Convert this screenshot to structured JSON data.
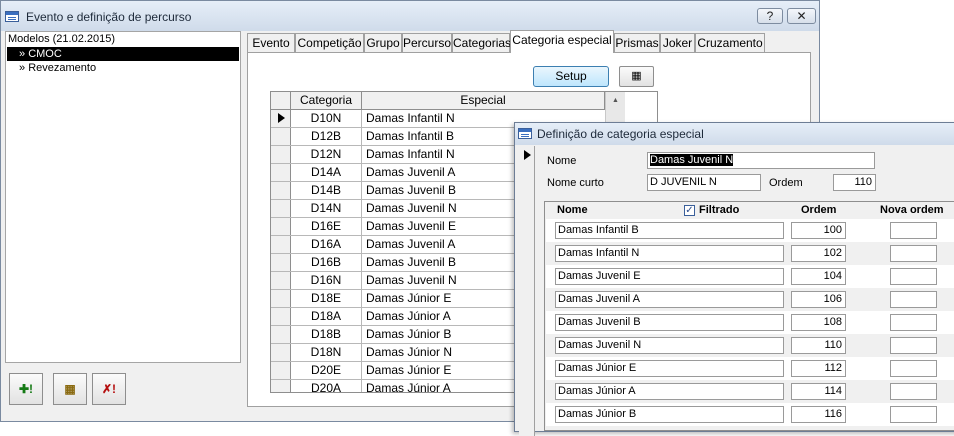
{
  "main_window": {
    "title": "Evento e definição de percurso",
    "help_glyph": "?",
    "close_glyph": "✕"
  },
  "tree": {
    "root": "Modelos (21.02.2015)",
    "items": [
      {
        "label": "CMOC",
        "selected": true
      },
      {
        "label": "Revezamento",
        "selected": false
      }
    ]
  },
  "bottom_buttons": [
    {
      "icon": "add-icon",
      "glyph": "✚!"
    },
    {
      "icon": "edit-table-icon",
      "glyph": "▦"
    },
    {
      "icon": "delete-icon",
      "glyph": "✗!"
    }
  ],
  "tabs": [
    {
      "label": "Evento"
    },
    {
      "label": "Competição"
    },
    {
      "label": "Grupo"
    },
    {
      "label": "Percurso"
    },
    {
      "label": "Categorias"
    },
    {
      "label": "Categoria especial",
      "active": true
    },
    {
      "label": "Prismas"
    },
    {
      "label": "Joker"
    },
    {
      "label": "Cruzamento"
    }
  ],
  "toolbar": {
    "setup_label": "Setup",
    "add_glyph": "▦"
  },
  "grid": {
    "columns": [
      "Categoria",
      "Especial"
    ],
    "rows": [
      {
        "cat": "D10N",
        "esp": "Damas Infantil N"
      },
      {
        "cat": "D12B",
        "esp": "Damas Infantil B"
      },
      {
        "cat": "D12N",
        "esp": "Damas Infantil N"
      },
      {
        "cat": "D14A",
        "esp": "Damas Juvenil A"
      },
      {
        "cat": "D14B",
        "esp": "Damas Juvenil B"
      },
      {
        "cat": "D14N",
        "esp": "Damas Juvenil N"
      },
      {
        "cat": "D16E",
        "esp": "Damas Juvenil E"
      },
      {
        "cat": "D16A",
        "esp": "Damas Juvenil A"
      },
      {
        "cat": "D16B",
        "esp": "Damas Juvenil B"
      },
      {
        "cat": "D16N",
        "esp": "Damas Juvenil N"
      },
      {
        "cat": "D18E",
        "esp": "Damas Júnior E"
      },
      {
        "cat": "D18A",
        "esp": "Damas Júnior A"
      },
      {
        "cat": "D18B",
        "esp": "Damas Júnior B"
      },
      {
        "cat": "D18N",
        "esp": "Damas Júnior N"
      },
      {
        "cat": "D20E",
        "esp": "Damas Júnior E"
      },
      {
        "cat": "D20A",
        "esp": "Damas Júnior A"
      }
    ]
  },
  "dialog": {
    "title": "Definição de categoria especial",
    "nome_label": "Nome",
    "nome_value": "Damas Juvenil N",
    "nome_curto_label": "Nome curto",
    "nome_curto_value": "D JUVENIL N",
    "ordem_label": "Ordem",
    "ordem_value": "110",
    "sub_headers": {
      "nome": "Nome",
      "filtrado": "Filtrado",
      "ordem": "Ordem",
      "nova_ordem": "Nova ordem"
    },
    "filtrado_checked": true,
    "rows": [
      {
        "nome": "Damas Infantil B",
        "ordem": "100",
        "nova": ""
      },
      {
        "nome": "Damas Infantil N",
        "ordem": "102",
        "nova": ""
      },
      {
        "nome": "Damas Juvenil E",
        "ordem": "104",
        "nova": ""
      },
      {
        "nome": "Damas Juvenil A",
        "ordem": "106",
        "nova": ""
      },
      {
        "nome": "Damas Juvenil B",
        "ordem": "108",
        "nova": ""
      },
      {
        "nome": "Damas Juvenil N",
        "ordem": "110",
        "nova": ""
      },
      {
        "nome": "Damas Júnior E",
        "ordem": "112",
        "nova": ""
      },
      {
        "nome": "Damas Júnior A",
        "ordem": "114",
        "nova": ""
      },
      {
        "nome": "Damas Júnior B",
        "ordem": "116",
        "nova": ""
      }
    ]
  }
}
